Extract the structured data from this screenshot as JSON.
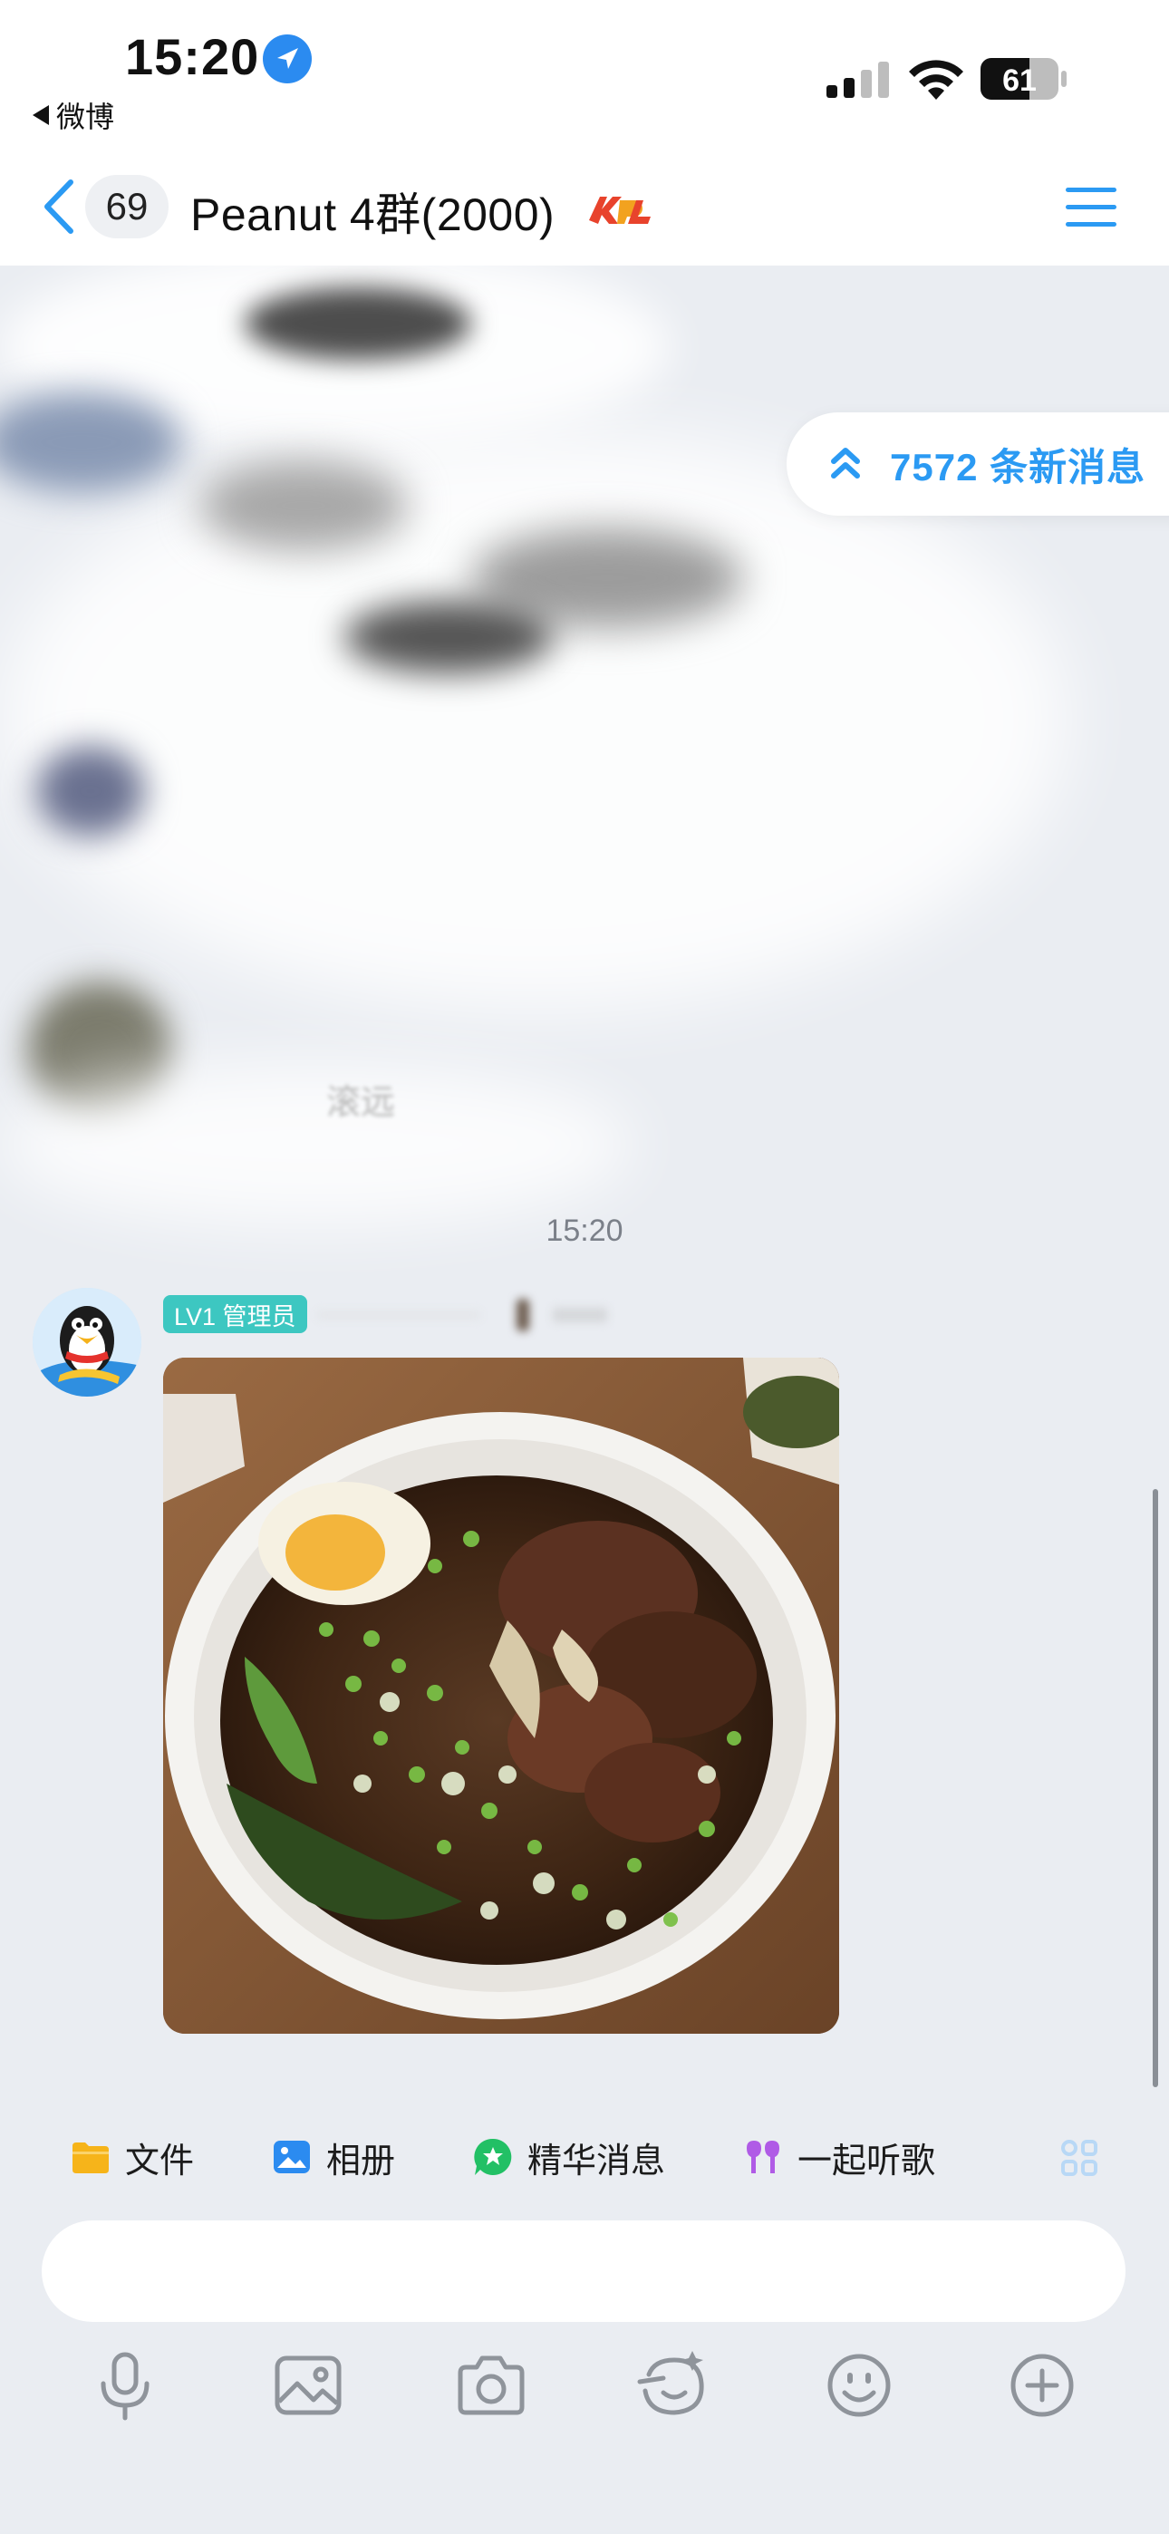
{
  "status_bar": {
    "time": "15:20",
    "back_app": "微博",
    "battery": "61"
  },
  "nav": {
    "unread_count": "69",
    "title": "Peanut 4群(2000)",
    "badge_icon": "kpl-logo-icon",
    "menu_icon": "menu-icon"
  },
  "chat": {
    "new_messages": "7572 条新消息",
    "blurred_text_fragment": "滚远",
    "timestamp": "15:20",
    "message": {
      "sender_badge": "LV1 管理员",
      "avatar_icon": "qq-penguin-avatar",
      "content_type": "image"
    }
  },
  "shortcuts": [
    {
      "label": "文件",
      "icon": "folder-icon"
    },
    {
      "label": "相册",
      "icon": "album-icon"
    },
    {
      "label": "精华消息",
      "icon": "star-bubble-icon"
    },
    {
      "label": "一起听歌",
      "icon": "earbuds-icon"
    }
  ],
  "input": {
    "placeholder": ""
  },
  "toolbar_icons": [
    "microphone-icon",
    "image-icon",
    "camera-icon",
    "emoji-shop-icon",
    "smile-icon",
    "plus-icon"
  ],
  "colors": {
    "accent": "#2b9af3",
    "badge": "#3dc7c1",
    "background": "#eaedf2"
  }
}
